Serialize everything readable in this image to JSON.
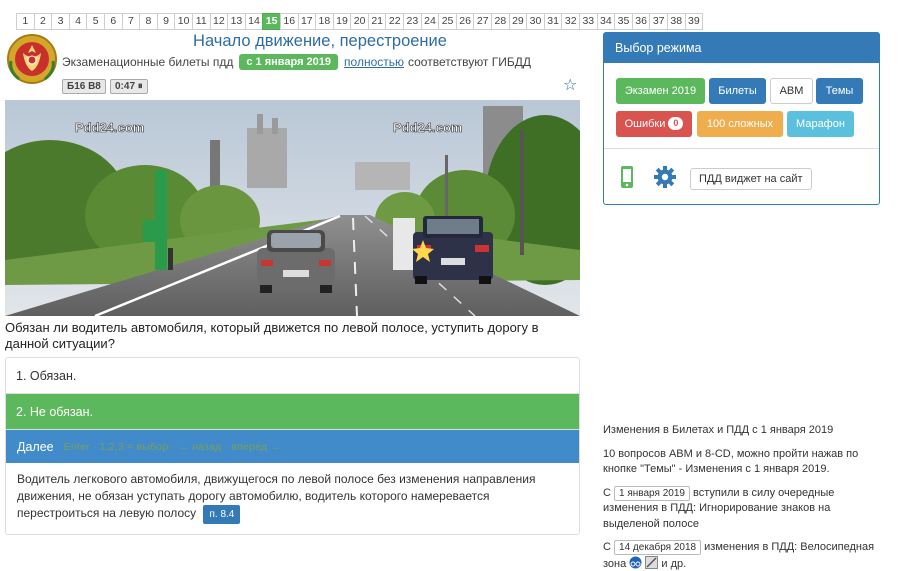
{
  "question_numbers": [
    "1",
    "2",
    "3",
    "4",
    "5",
    "6",
    "7",
    "8",
    "9",
    "10",
    "11",
    "12",
    "13",
    "14",
    "15",
    "16",
    "17",
    "18",
    "19",
    "20",
    "21",
    "22",
    "23",
    "24",
    "25",
    "26",
    "27",
    "28",
    "29",
    "30",
    "31",
    "32",
    "33",
    "34",
    "35",
    "36",
    "37",
    "38",
    "39"
  ],
  "active_question": "15",
  "header": {
    "title": "Начало движение, перестроение",
    "subtitle_prefix": "Экзаменационные билеты пдд",
    "date_badge": "с 1 января 2019",
    "link_text": "полностью",
    "subtitle_suffix": "соответствуют ГИБДД",
    "ticket_tag": "Б16 В8",
    "timer_tag": "0:47 ⏸"
  },
  "photo": {
    "watermark_left": "Pdd24.com",
    "watermark_right": "Pdd24.com"
  },
  "question_text": "Обязан ли водитель автомобиля, который движется по левой полосе, уступить дорогу в данной ситуации?",
  "answers": [
    {
      "text": "1. Обязан."
    },
    {
      "text": "2. Не обязан."
    }
  ],
  "next": {
    "label": "Далее",
    "hint": "Enter · 1,2,3 = выбор · ← назад · вперед →"
  },
  "explanation": {
    "text": "Водитель легкового автомобиля, движущегося по левой полосе без изменения направления движения, не обязан уступать дорогу автомобилю, водитель которого намеревается перестроиться на левую полосу",
    "rule_badge": "п. 8.4"
  },
  "mode_panel": {
    "title": "Выбор режима",
    "buttons": {
      "exam": "Экзамен 2019",
      "tickets": "Билеты",
      "abm": "АВМ",
      "topics": "Темы",
      "errors": "Ошибки",
      "errors_count": "0",
      "hard": "100 сложных",
      "marathon": "Марафон"
    },
    "widget_button": "ПДД виджет на сайт",
    "colors": {
      "primary": "#337ab7",
      "success": "#5cb85c",
      "danger": "#d9534f",
      "warning": "#f0ad4e",
      "info": "#5bc0de"
    }
  },
  "news": {
    "item1": "Изменения в Билетах и ПДД с 1 января 2019",
    "item2": "10 вопросов АВМ и 8-CD, можно пройти нажав по кнопке \"Темы\" - Изменения с 1 января 2019.",
    "item3_prefix": "С",
    "item3_date": "1 января 2019",
    "item3_text": "вступили в силу очередные изменения в ПДД: Игнорирование знаков на выделеной полосе",
    "item4_prefix": "С",
    "item4_date": "14 декабря 2018",
    "item4_text": "изменения в ПДД: Велосипедная зона",
    "item4_suffix": "и др."
  }
}
